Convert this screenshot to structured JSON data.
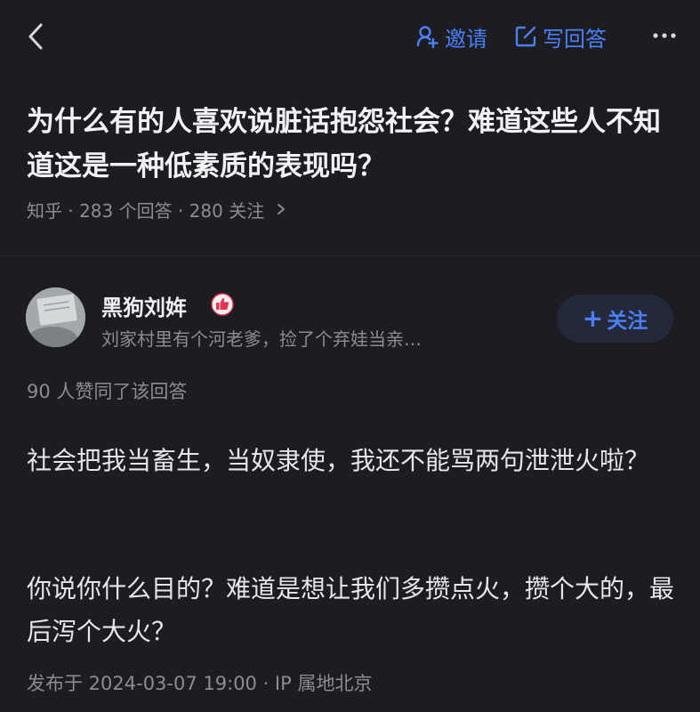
{
  "topbar": {
    "invite_label": "邀请",
    "write_answer_label": "写回答",
    "accent_color": "#4a7ff7"
  },
  "question": {
    "title": "为什么有的人喜欢说脏话抱怨社会？难道这些人不知道这是一种低素质的表现吗？",
    "meta": "知乎 · 283 个回答 · 280 关注"
  },
  "author": {
    "name": "黑狗刘姩",
    "bio": "刘家村里有个河老爹，捡了个弃娃当亲…",
    "badge_icon": "thumbs-up-badge-icon",
    "follow_label": "关注"
  },
  "answer": {
    "vote_text": "90 人赞同了该回答",
    "paragraphs": [
      "社会把我当畜生，当奴隶使，我还不能骂两句泄泄火啦？",
      "你说你什么目的？难道是想让我们多攒点火，攒个大的，最后泻个大火？"
    ],
    "publish_info": "发布于 2024-03-07 19:00 · IP 属地北京"
  }
}
